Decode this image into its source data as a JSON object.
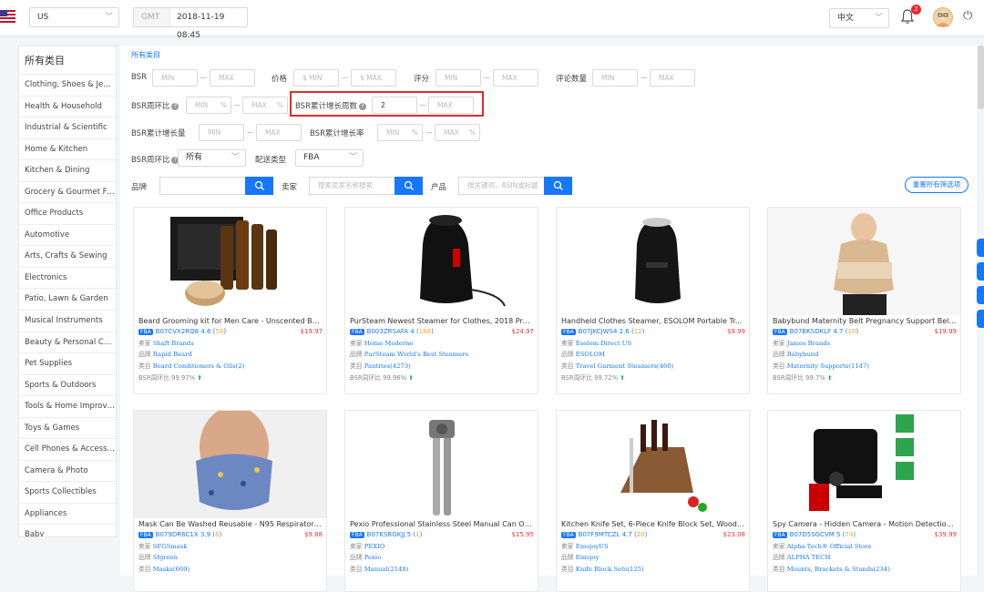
{
  "topbar": {
    "country": "US",
    "timezone_prefix": "GMT",
    "datetime": "2018-11-19 08:45",
    "language": "中文",
    "notification_count": "2"
  },
  "sidebar": {
    "heading": "所有类目",
    "items": [
      "Clothing, Shoes & Jewe...",
      "Health & Household",
      "Industrial & Scientific",
      "Home & Kitchen",
      "Kitchen & Dining",
      "Grocery & Gourmet Fo...",
      "Office Products",
      "Automotive",
      "Arts, Crafts & Sewing",
      "Electronics",
      "Patio, Lawn & Garden",
      "Musical Instruments",
      "Beauty & Personal Care",
      "Pet Supplies",
      "Sports & Outdoors",
      "Tools & Home Improve...",
      "Toys & Games",
      "Cell Phones & Accessor...",
      "Camera & Photo",
      "Sports Collectibles",
      "Appliances",
      "Baby"
    ]
  },
  "filters": {
    "breadcrumb": "所有类目",
    "bsr_label": "BSR",
    "price_label": "价格",
    "rating_label": "评分",
    "review_count_label": "评论数量",
    "bsr_wow_label": "BSR周环比",
    "bsr_growth_weeks_label": "BSR累计增长周数",
    "bsr_growth_weeks_value": "2",
    "bsr_growth_amount_label": "BSR累计增长量",
    "bsr_growth_rate_label": "BSR累计增长率",
    "bsr_wow_select_label": "BSR周环比",
    "bsr_wow_select_value": "所有",
    "delivery_label": "配送类型",
    "delivery_value": "FBA",
    "brand_label": "品牌",
    "seller_label": "卖家",
    "seller_placeholder": "搜索卖家名称搜索",
    "product_label": "产品",
    "product_placeholder": "搜关键词，ASIN或标题",
    "min": "MIN",
    "max": "MAX",
    "currency": "$",
    "percent": "%",
    "reset_button": "重置所有筛选项"
  },
  "labels": {
    "seller": "卖家",
    "brand": "品牌",
    "category": "类目",
    "bsr_wow": "BSR周环比"
  },
  "products": [
    {
      "title": "Beard Grooming kit for Men Care - Unscented Be...",
      "badge": "FBA",
      "asin": "B07CVX2RQ8",
      "rating": "4.6",
      "reviews": "50",
      "price": "$19.97",
      "seller": "Shaft Brands",
      "brand": "Rapid Beard",
      "category": "Beard Conditioners & Oils(2)",
      "bsr_wow": "99.97%"
    },
    {
      "title": "PurSteam Newest Steamer for Clothes, 2018 Pre...",
      "badge": "FBA",
      "asin": "B003ZRSAFA",
      "rating": "4",
      "reviews": "188",
      "price": "$24.97",
      "seller": "Home Moderne",
      "brand": "PurSteam World's Best Steamers",
      "category": "Pantries(4273)",
      "bsr_wow": "99.96%"
    },
    {
      "title": "Handheld Clothes Steamer, ESOLOM Portable Tr...",
      "badge": "FBA",
      "asin": "B07JKCJWS4",
      "rating": "2.6",
      "reviews": "12",
      "price": "$9.99",
      "seller": "Esolom Direct US",
      "brand": "ESOLOM",
      "category": "Travel Garment Steamers(460)",
      "bsr_wow": "99.72%"
    },
    {
      "title": "Babybund Maternity Belt Pregnancy Support Belt...",
      "badge": "FBA",
      "asin": "B07BKSDKLF",
      "rating": "4.7",
      "reviews": "10",
      "price": "$19.99",
      "seller": "James Brands",
      "brand": "Babybund",
      "category": "Maternity Supports(1147)",
      "bsr_wow": "99.7%"
    },
    {
      "title": "Mask Can Be Washed Reusable - N95 Respirator ...",
      "badge": "FBA",
      "asin": "B079DR6C1X",
      "rating": "3.9",
      "reviews": "8",
      "price": "$9.88",
      "seller": "SFGSmask",
      "brand": "Sfgreen",
      "category": "Masks(669)",
      "bsr_wow": ""
    },
    {
      "title": "Pexio Professional Stainless Steel Manual Can Op...",
      "badge": "FBA",
      "asin": "B07KSRGKJJ",
      "rating": "5",
      "reviews": "1",
      "price": "$15.95",
      "seller": "PEXIO",
      "brand": "Pexio",
      "category": "Manual(2148)",
      "bsr_wow": ""
    },
    {
      "title": "Kitchen Knife Set, 6-Piece Knife Block Set, Woode...",
      "badge": "FBA",
      "asin": "B07F9MTCZL",
      "rating": "4.7",
      "reviews": "20",
      "price": "$23.08",
      "seller": "EmojoyUS",
      "brand": "Emojoy",
      "category": "Knife Block Sets(125)",
      "bsr_wow": ""
    },
    {
      "title": "Spy Camera - Hidden Camera - Motion Detection...",
      "badge": "FBA",
      "asin": "B07D5SGCVM",
      "rating": "5",
      "reviews": "74",
      "price": "$39.99",
      "seller": "Alpha-Tech® Official Store",
      "brand": "ALPHA TECH",
      "category": "Mounts, Brackets & Stands(234)",
      "bsr_wow": ""
    }
  ],
  "colors": {
    "accent": "#1677ff",
    "price": "#e4393c",
    "highlight": "#d93025"
  }
}
